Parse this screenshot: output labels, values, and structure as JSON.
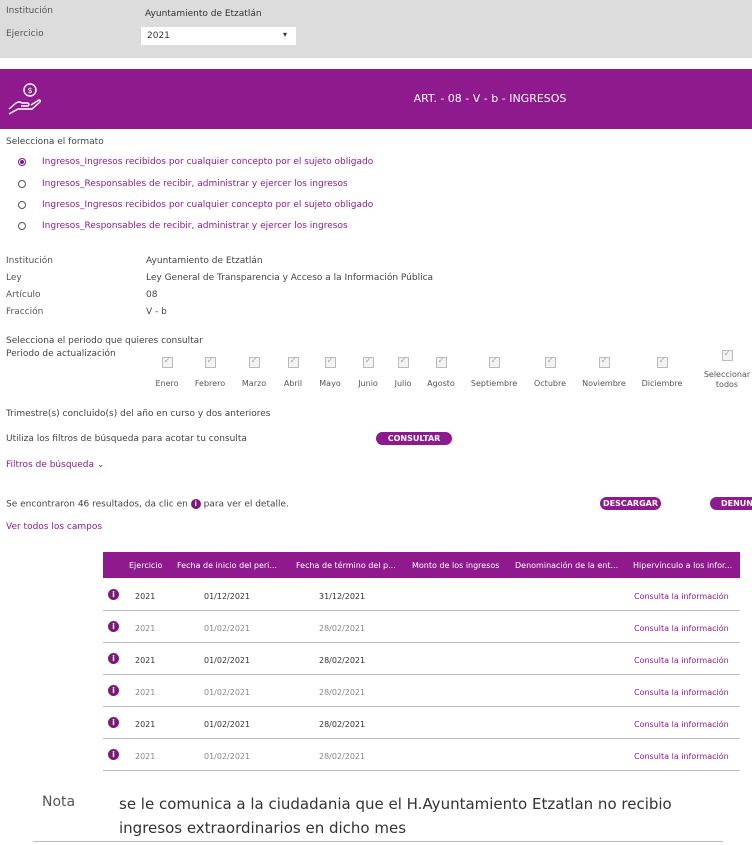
{
  "header": {
    "institucion_label": "Institución",
    "institucion_value": "Ayuntamiento de Etzatlán",
    "ejercicio_label": "Ejercicio",
    "ejercicio_value": "2021"
  },
  "banner": {
    "title": "ART. - 08 - V - b - INGRESOS",
    "icon": "money-hand-icon"
  },
  "formato": {
    "label": "Selecciona el formato",
    "options": [
      {
        "text": "Ingresos_Ingresos recibidos por cualquier concepto por el sujeto obligado",
        "checked": true
      },
      {
        "text": "Ingresos_Responsables de recibir, administrar y ejercer los ingresos",
        "checked": false
      },
      {
        "text": "Ingresos_Ingresos recibidos por cualquier concepto por el sujeto obligado",
        "checked": false
      },
      {
        "text": "Ingresos_Responsables de recibir, administrar y ejercer los ingresos",
        "checked": false
      }
    ]
  },
  "info": {
    "institucion_label": "Institución",
    "institucion_value": "Ayuntamiento de Etzatlán",
    "ley_label": "Ley",
    "ley_value": "Ley General de Transparencia y Acceso a la Información Pública",
    "articulo_label": "Artículo",
    "articulo_value": "08",
    "fraccion_label": "Fracción",
    "fraccion_value": "V - b"
  },
  "periodo": {
    "label": "Selecciona el periodo que quieres consultar",
    "sublabel": "Periodo de actualización",
    "months": [
      "Enero",
      "Febrero",
      "Marzo",
      "Abril",
      "Mayo",
      "Junio",
      "Julio",
      "Agosto",
      "Septiembre",
      "Octubre",
      "Noviembre",
      "Diciembre"
    ],
    "select_all_line1": "Seleccionar",
    "select_all_line2": "todos"
  },
  "trimestre_text": "Trimestre(s) concluido(s) del año en curso y dos anteriores",
  "filtros_text": "Utiliza los filtros de búsqueda para acotar tu consulta",
  "consultar_label": "CONSULTAR",
  "filtros_link": "Filtros de búsqueda",
  "results": {
    "text_before": "Se encontraron 46 resultados, da clic en",
    "text_after": "para ver el detalle.",
    "descargar_label": "DESCARGAR",
    "denunciar_label": "DENUN",
    "ver_todos": "Ver todos los campos"
  },
  "table": {
    "headers": [
      "Ejercicio",
      "Fecha de inicio del peri...",
      "Fecha de término del p...",
      "Monto de los ingresos",
      "Denominación de la ent...",
      "Hipervínculo a los infor..."
    ],
    "rows": [
      {
        "ejercicio": "2021",
        "inicio": "01/12/2021",
        "termino": "31/12/2021",
        "monto": "",
        "denominacion": "",
        "link": "Consulta la información"
      },
      {
        "ejercicio": "2021",
        "inicio": "01/02/2021",
        "termino": "28/02/2021",
        "monto": "",
        "denominacion": "",
        "link": "Consulta la información"
      },
      {
        "ejercicio": "2021",
        "inicio": "01/02/2021",
        "termino": "28/02/2021",
        "monto": "",
        "denominacion": "",
        "link": "Consulta la información"
      },
      {
        "ejercicio": "2021",
        "inicio": "01/02/2021",
        "termino": "28/02/2021",
        "monto": "",
        "denominacion": "",
        "link": "Consulta la información"
      },
      {
        "ejercicio": "2021",
        "inicio": "01/02/2021",
        "termino": "28/02/2021",
        "monto": "",
        "denominacion": "",
        "link": "Consulta la información"
      },
      {
        "ejercicio": "2021",
        "inicio": "01/02/2021",
        "termino": "28/02/2021",
        "monto": "",
        "denominacion": "",
        "link": "Consulta la información"
      }
    ]
  },
  "note": {
    "label": "Nota",
    "text": "se le comunica a la ciudadania que el H.Ayuntamiento Etzatlan no recibio ingresos extraordinarios en dicho mes"
  },
  "colors": {
    "accent": "#8e1a8e",
    "topbar": "#dcdcdc"
  }
}
